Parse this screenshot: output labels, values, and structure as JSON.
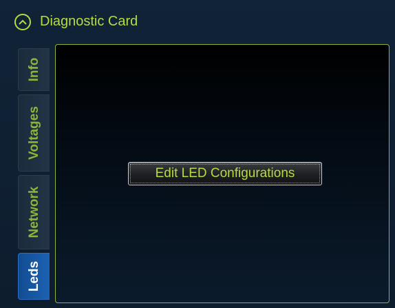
{
  "header": {
    "title": "Diagnostic Card",
    "collapse_icon": "chevron-up-icon",
    "accent_color": "#b6dc42"
  },
  "tabs": [
    {
      "label": "Info",
      "active": false
    },
    {
      "label": "Voltages",
      "active": false
    },
    {
      "label": "Network",
      "active": false
    },
    {
      "label": "Leds",
      "active": true
    }
  ],
  "content": {
    "edit_button_label": "Edit LED Configurations"
  },
  "colors": {
    "active_tab": "#1c62b2",
    "panel_border": "#8fb43a"
  }
}
